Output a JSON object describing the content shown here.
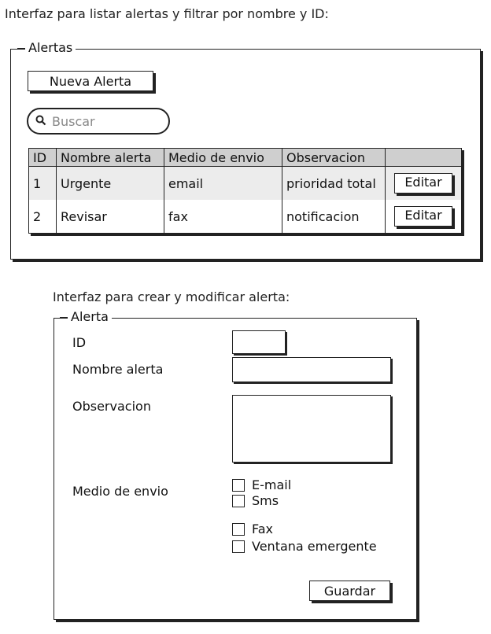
{
  "list_section": {
    "caption": "Interfaz para listar alertas y filtrar por nombre y ID:",
    "legend": "Alertas",
    "new_button": "Nueva Alerta",
    "search_placeholder": "Buscar",
    "columns": [
      "ID",
      "Nombre alerta",
      "Medio de envio",
      "Observacion",
      ""
    ],
    "rows": [
      {
        "id": "1",
        "name": "Urgente",
        "medium": "email",
        "note": "prioridad total",
        "action": "Editar"
      },
      {
        "id": "2",
        "name": "Revisar",
        "medium": "fax",
        "note": "notificacion",
        "action": "Editar"
      }
    ]
  },
  "form_section": {
    "caption": "Interfaz para crear y modificar alerta:",
    "legend": "Alerta",
    "labels": {
      "id": "ID",
      "name": "Nombre alerta",
      "observation": "Observacion",
      "medium": "Medio de envio"
    },
    "options": [
      "E-mail",
      "Sms",
      "Fax",
      "Ventana emergente"
    ],
    "save_button": "Guardar"
  },
  "icons": {
    "search": "search-icon"
  }
}
